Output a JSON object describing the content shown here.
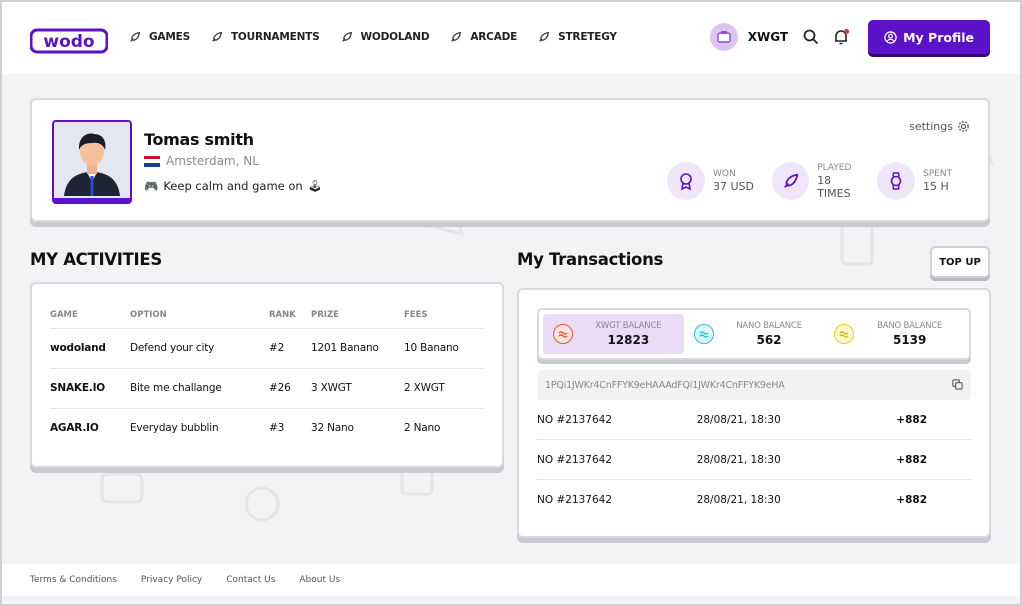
{
  "header": {
    "logo_text": "wodo",
    "nav": [
      {
        "label": "GAMES",
        "icon": "rocket-icon"
      },
      {
        "label": "TOURNAMENTS",
        "icon": "rocket-icon"
      },
      {
        "label": "WODOLAND",
        "icon": "rocket-icon"
      },
      {
        "label": "ARCADE",
        "icon": "rocket-icon"
      },
      {
        "label": "STRETEGY",
        "icon": "rocket-icon"
      }
    ],
    "coin_label": "XWGT",
    "profile_button": "My Profile"
  },
  "profile": {
    "name": "Tomas smith",
    "location": "Amsterdam, NL",
    "bio": "Keep calm and game on",
    "settings_label": "settings",
    "stats": [
      {
        "label": "WON",
        "value": "37 USD",
        "icon": "medal-icon"
      },
      {
        "label": "PLAYED",
        "value": "18 TIMES",
        "icon": "rocket-icon"
      },
      {
        "label": "SPENT",
        "value": "15 H",
        "icon": "watch-icon"
      }
    ]
  },
  "activities": {
    "title": "MY ACTIVITIES",
    "columns": [
      "GAME",
      "OPTION",
      "RANK",
      "PRIZE",
      "FEES"
    ],
    "rows": [
      [
        "wodoland",
        "Defend your city",
        "#2",
        "1201 Banano",
        "10 Banano"
      ],
      [
        "SNAKE.IO",
        "Bite me challange",
        "#26",
        "3 XWGT",
        "2 XWGT"
      ],
      [
        "AGAR.IO",
        "Everyday bubblin",
        "#3",
        "32 Nano",
        "2 Nano"
      ]
    ]
  },
  "transactions": {
    "title": "My Transactions",
    "topup_label": "TOP UP",
    "balances": [
      {
        "label": "XWGT BALANCE",
        "value": "12823",
        "color": "#e4572e",
        "bg": "#fbe3dc",
        "active": true
      },
      {
        "label": "NANO BALANCE",
        "value": "562",
        "color": "#27c3d8",
        "bg": "#dcf6fa",
        "active": false
      },
      {
        "label": "BANO BALANCE",
        "value": "5139",
        "color": "#e6d21d",
        "bg": "#fbf6d1",
        "active": false
      }
    ],
    "address": "1PQi1JWKr4CnFFYK9eHAAAdFQi1JWKr4CnFFYK9eHA",
    "rows": [
      {
        "id": "NO #2137642",
        "date": "28/08/21, 18:30",
        "amount": "+882"
      },
      {
        "id": "NO #2137642",
        "date": "28/08/21, 18:30",
        "amount": "+882"
      },
      {
        "id": "NO #2137642",
        "date": "28/08/21, 18:30",
        "amount": "+882"
      }
    ]
  },
  "footer": {
    "links": [
      "Terms & Conditions",
      "Privacy Policy",
      "Contact Us",
      "About Us"
    ]
  },
  "colors": {
    "brand": "#5b12c8",
    "brand_shadow": "#31076f"
  }
}
